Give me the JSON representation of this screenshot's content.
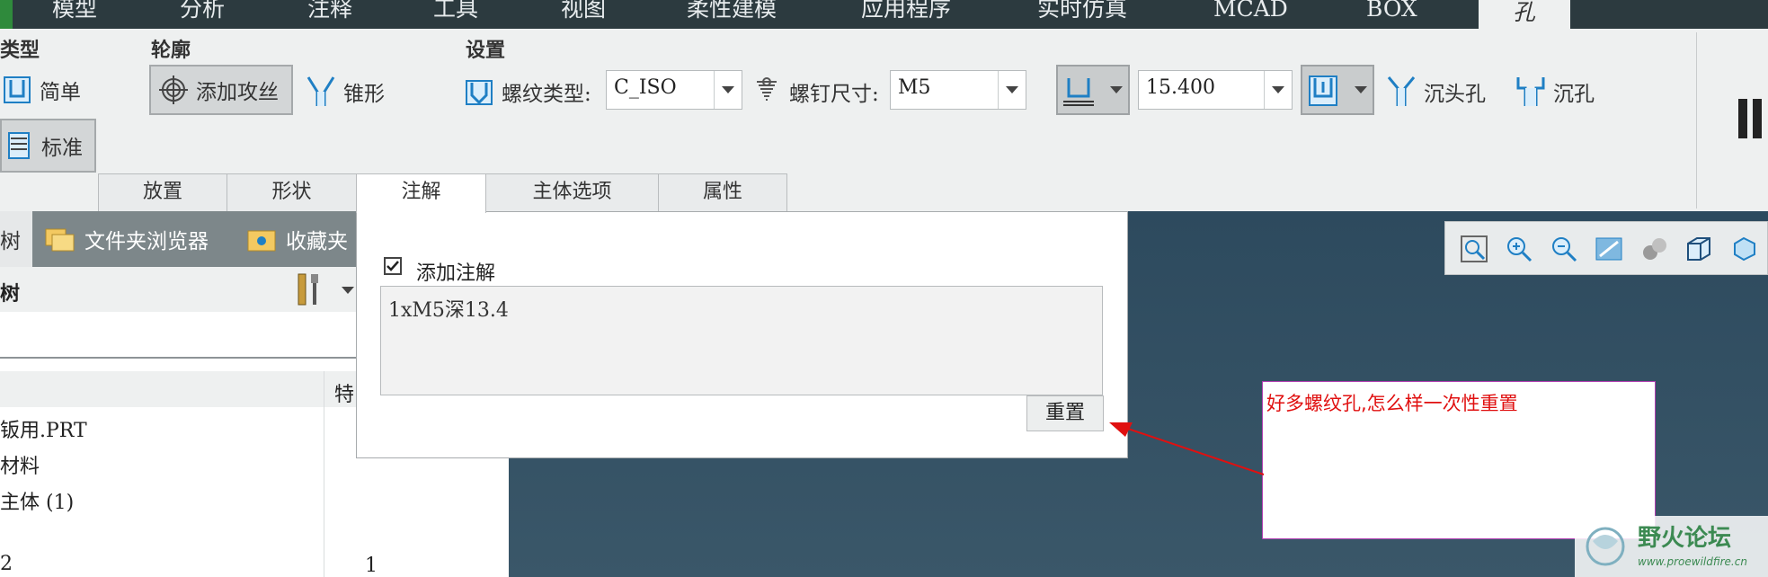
{
  "menu": {
    "items": [
      "模型",
      "分析",
      "注释",
      "工具",
      "视图",
      "柔性建模",
      "应用程序",
      "实时仿真",
      "MCAD",
      "BOX"
    ],
    "active_tab": "孔"
  },
  "ribbon": {
    "type_group": {
      "title": "类型",
      "simple": "简单",
      "standard": "标准"
    },
    "profile_group": {
      "title": "轮廓",
      "add_tap": "添加攻丝",
      "taper": "锥形"
    },
    "settings_group": {
      "title": "设置",
      "thread_type_label": "螺纹类型:",
      "thread_type_value": "C_ISO",
      "screw_size_label": "螺钉尺寸:",
      "screw_size_value": "M5",
      "depth_value": "15.400",
      "countersink": "沉头孔",
      "counterbore": "沉孔"
    }
  },
  "tabs": [
    "放置",
    "形状",
    "注解",
    "主体选项",
    "属性"
  ],
  "active_tab_index": 2,
  "left_panel": {
    "tab_model_tree": "树",
    "tab_folder_browser": "文件夹浏览器",
    "tab_favorites": "收藏夹",
    "tree_title": "树",
    "column_feature": "特",
    "rows": [
      "钣用.PRT",
      "材料",
      "主体 (1)",
      "",
      "2"
    ],
    "row_value": "1"
  },
  "annotation_panel": {
    "add_note_label": "添加注解",
    "add_note_checked": true,
    "note_text": "1xM5深13.4",
    "reset_button": "重置"
  },
  "callout": {
    "text": "好多螺纹孔,怎么样一次性重置"
  },
  "watermark": {
    "title": "野火论坛",
    "url": "www.proewildfire.cn"
  },
  "colors": {
    "accent_red": "#e01010",
    "graphics_bg": "#2d4a5e",
    "menubar_bg": "#2c3a3f"
  }
}
